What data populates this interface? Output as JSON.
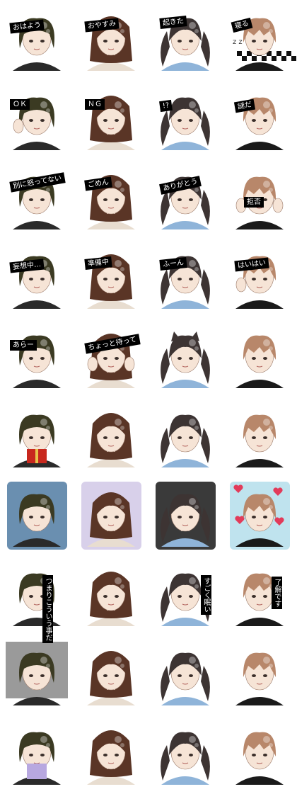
{
  "sticker_sheet": {
    "rows": [
      [
        "おはよう",
        "おやすみ",
        "起きた",
        "寝る"
      ],
      [
        "ＯＫ",
        "ＮＧ",
        "!?",
        "謎だ"
      ],
      [
        "別に怒ってない",
        "ごめん",
        "ありがとう",
        "拒否"
      ],
      [
        "妄想中…",
        "準備中",
        "ふーん",
        "はいはい"
      ],
      [
        "あらー",
        "ちょっと待って",
        "",
        ""
      ],
      [
        "",
        "",
        "",
        ""
      ],
      [
        "",
        "",
        "",
        ""
      ],
      [
        "つまりこういう事だ",
        "",
        "すごく眠い",
        "了解です"
      ],
      [
        "",
        "",
        "",
        ""
      ],
      [
        "",
        "",
        "",
        ""
      ]
    ]
  },
  "colors": {
    "hair_olive": "#3b3a22",
    "hair_brown": "#5a3526",
    "hair_dark": "#3d3433",
    "hair_light": "#b8876a",
    "skin": "#f6e4d6",
    "shirt_blue": "#8fb4d9",
    "shirt_black": "#1a1a1a",
    "label_bg": "#000000",
    "label_fg": "#ffffff"
  },
  "characters": [
    "olive-bob-girl",
    "brown-wavy-girl",
    "twin-tail-girl",
    "light-hair-boy"
  ],
  "icons": [
    "sparkle-bubble-icon",
    "zzz-icon",
    "heart-icon",
    "gift-icon"
  ]
}
